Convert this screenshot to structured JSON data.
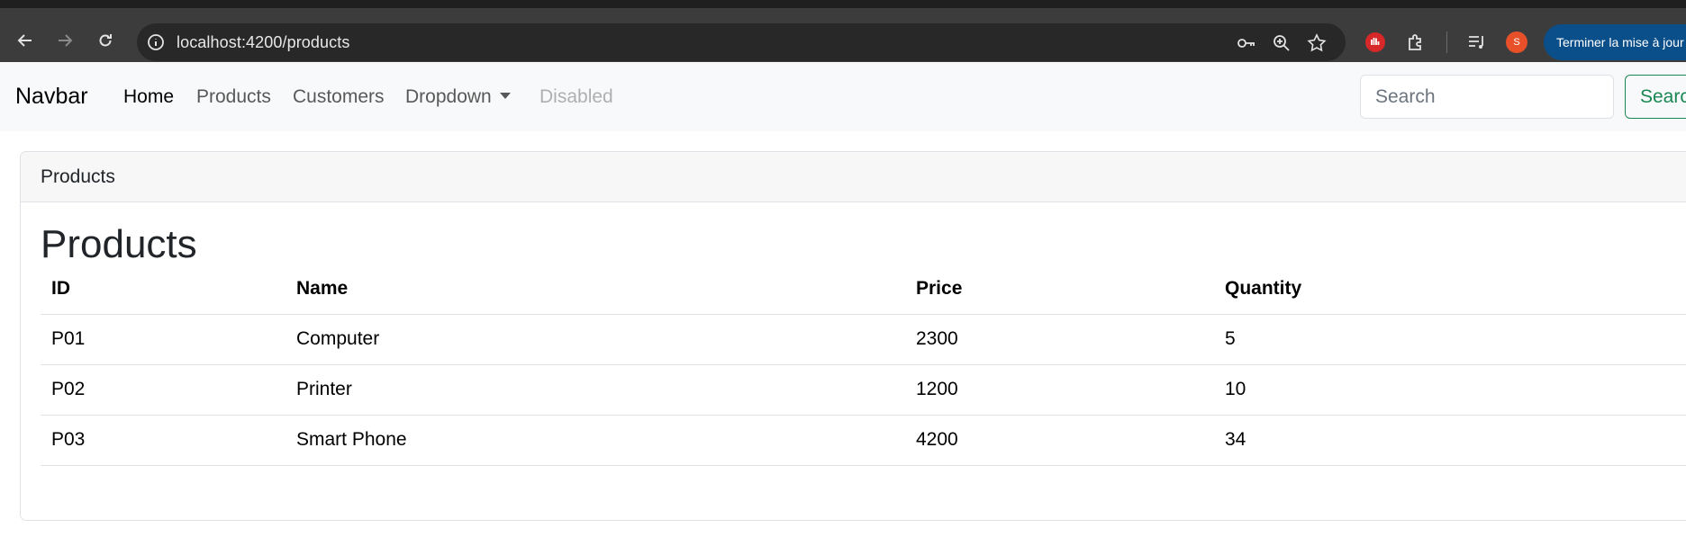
{
  "browser": {
    "url": "localhost:4200/products",
    "update_button": "Terminer la mise à jour",
    "profile_initial": "S"
  },
  "navbar": {
    "brand": "Navbar",
    "links": {
      "home": "Home",
      "products": "Products",
      "customers": "Customers",
      "dropdown": "Dropdown",
      "disabled": "Disabled"
    },
    "search": {
      "placeholder": "Search",
      "button": "Search"
    }
  },
  "card": {
    "header": "Products",
    "title": "Products",
    "table": {
      "columns": [
        "ID",
        "Name",
        "Price",
        "Quantity"
      ],
      "rows": [
        [
          "P01",
          "Computer",
          "2300",
          "5"
        ],
        [
          "P02",
          "Printer",
          "1200",
          "10"
        ],
        [
          "P03",
          "Smart Phone",
          "4200",
          "34"
        ]
      ]
    }
  },
  "colors": {
    "browser_bg": "#3c3c3c",
    "navbar_bg": "#f8f9fa",
    "success": "#198754",
    "update_pill": "#0b4f8a"
  }
}
